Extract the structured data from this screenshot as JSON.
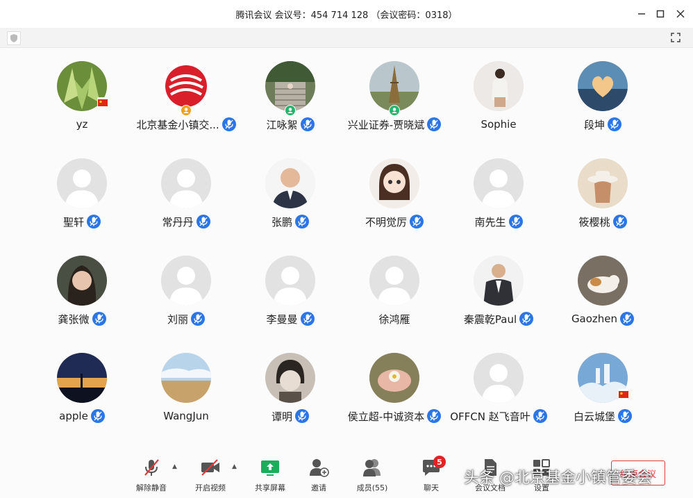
{
  "window": {
    "title": "腾讯会议 会议号：454 714 128 （会议密码：0318）"
  },
  "participants": [
    {
      "name": "yz",
      "avatar": "succulent-photo",
      "badge": "china-flag",
      "mic": false
    },
    {
      "name": "北京基金小镇交...",
      "avatar": "logo-red",
      "badge": "host-icon",
      "mic": true
    },
    {
      "name": "江咏絮",
      "avatar": "stairs-photo",
      "badge": "cohost-icon",
      "mic": true
    },
    {
      "name": "兴业证券-贾晓斌",
      "avatar": "tower-photo",
      "badge": "cohost-icon",
      "mic": true
    },
    {
      "name": "Sophie",
      "avatar": "woman-photo",
      "badge": "",
      "mic": false
    },
    {
      "name": "段坤",
      "avatar": "heart-photo",
      "badge": "",
      "mic": true
    },
    {
      "name": "聖轩",
      "avatar": "default",
      "badge": "",
      "mic": true
    },
    {
      "name": "常丹丹",
      "avatar": "default",
      "badge": "",
      "mic": true
    },
    {
      "name": "张鹏",
      "avatar": "man-photo",
      "badge": "",
      "mic": true
    },
    {
      "name": "不明觉厉",
      "avatar": "cartoon-girl",
      "badge": "",
      "mic": true
    },
    {
      "name": "南先生",
      "avatar": "default",
      "badge": "",
      "mic": true
    },
    {
      "name": "筱樱桃",
      "avatar": "hat-photo",
      "badge": "",
      "mic": true
    },
    {
      "name": "龚张微",
      "avatar": "selfie-photo",
      "badge": "",
      "mic": true
    },
    {
      "name": "刘丽",
      "avatar": "default",
      "badge": "",
      "mic": true
    },
    {
      "name": "李曼曼",
      "avatar": "default",
      "badge": "",
      "mic": true
    },
    {
      "name": "徐鸿雁",
      "avatar": "default",
      "badge": "",
      "mic": false
    },
    {
      "name": "秦震乾Paul",
      "avatar": "suit-photo",
      "badge": "",
      "mic": true
    },
    {
      "name": "Gaozhen",
      "avatar": "cat-photo",
      "badge": "",
      "mic": true
    },
    {
      "name": "apple",
      "avatar": "sunset-photo",
      "badge": "",
      "mic": true
    },
    {
      "name": "WangJun",
      "avatar": "desert-photo",
      "badge": "",
      "mic": false
    },
    {
      "name": "谭明",
      "avatar": "child-photo",
      "badge": "",
      "mic": true
    },
    {
      "name": "侯立超-中诚资本",
      "avatar": "flower-photo",
      "badge": "",
      "mic": true
    },
    {
      "name": "OFFCN 赵飞音叶",
      "avatar": "default",
      "badge": "",
      "mic": true
    },
    {
      "name": "白云城堡",
      "avatar": "castle-photo",
      "badge": "china-flag",
      "mic": true
    }
  ],
  "toolbar": {
    "unmute": "解除静音",
    "start_video": "开启视频",
    "share_screen": "共享屏幕",
    "invite": "邀请",
    "members": "成员(55)",
    "chat": "聊天",
    "chat_badge": "5",
    "docs": "会议文档",
    "settings": "设置",
    "end": "结束会议"
  },
  "watermark": "头条 @北京基金小镇管委会",
  "colors": {
    "mic_blue": "#2a76e8",
    "danger_red": "#e03b3b",
    "badge_red": "#e02424",
    "share_green": "#1aad5a"
  }
}
